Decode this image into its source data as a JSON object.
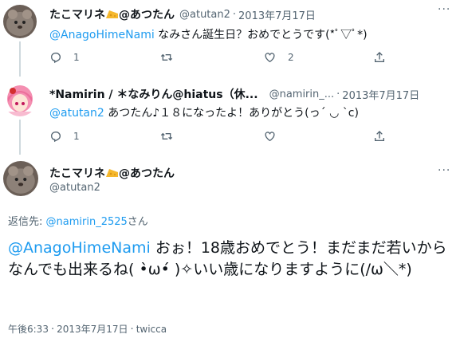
{
  "tweet1": {
    "display_name_prefix": "たこマリネ",
    "display_name_suffix": "@あつたん",
    "handle": "@atutan2",
    "separator": "·",
    "date": "2013年7月17日",
    "mention": "@AnagoHimeNami",
    "text": " なみさん誕生日？おめでとうです(*ﾟ▽ﾟ*)",
    "reply_count": "1",
    "like_count": "2"
  },
  "tweet2": {
    "display_name": "*Namirin / ＊なみりん@hiatus（休...",
    "handle": "@namirin_...",
    "separator": "·",
    "date": "2013年7月17日",
    "mention": "@atutan2",
    "text": " あつたん♪１８になったよ！ありがとう(っ´ ◡ `c)",
    "reply_count": "1"
  },
  "main_tweet": {
    "display_name_prefix": "たこマリネ",
    "display_name_suffix": "@あつたん",
    "handle": "@atutan2",
    "replying_label": "返信先: ",
    "replying_handle": "@namirin_2525",
    "replying_suffix": "さん",
    "mention": "@AnagoHimeNami",
    "text": " おぉ！18歳おめでとう！まだまだ若いからなんでも出来るね( •̀ω•́ )✧いい歳になりますように(/ω＼*)",
    "time": "午後6:33",
    "separator": "·",
    "date": "2013年7月17日",
    "source": "twicca"
  },
  "icons": {
    "reply": "reply-icon",
    "retweet": "retweet-icon",
    "like": "heart-icon",
    "share": "share-icon",
    "more": "more-icon",
    "cheese": "cheese-emoji-icon"
  },
  "colors": {
    "link": "#1d9bf0",
    "secondary": "#536471",
    "text": "#0f1419"
  }
}
